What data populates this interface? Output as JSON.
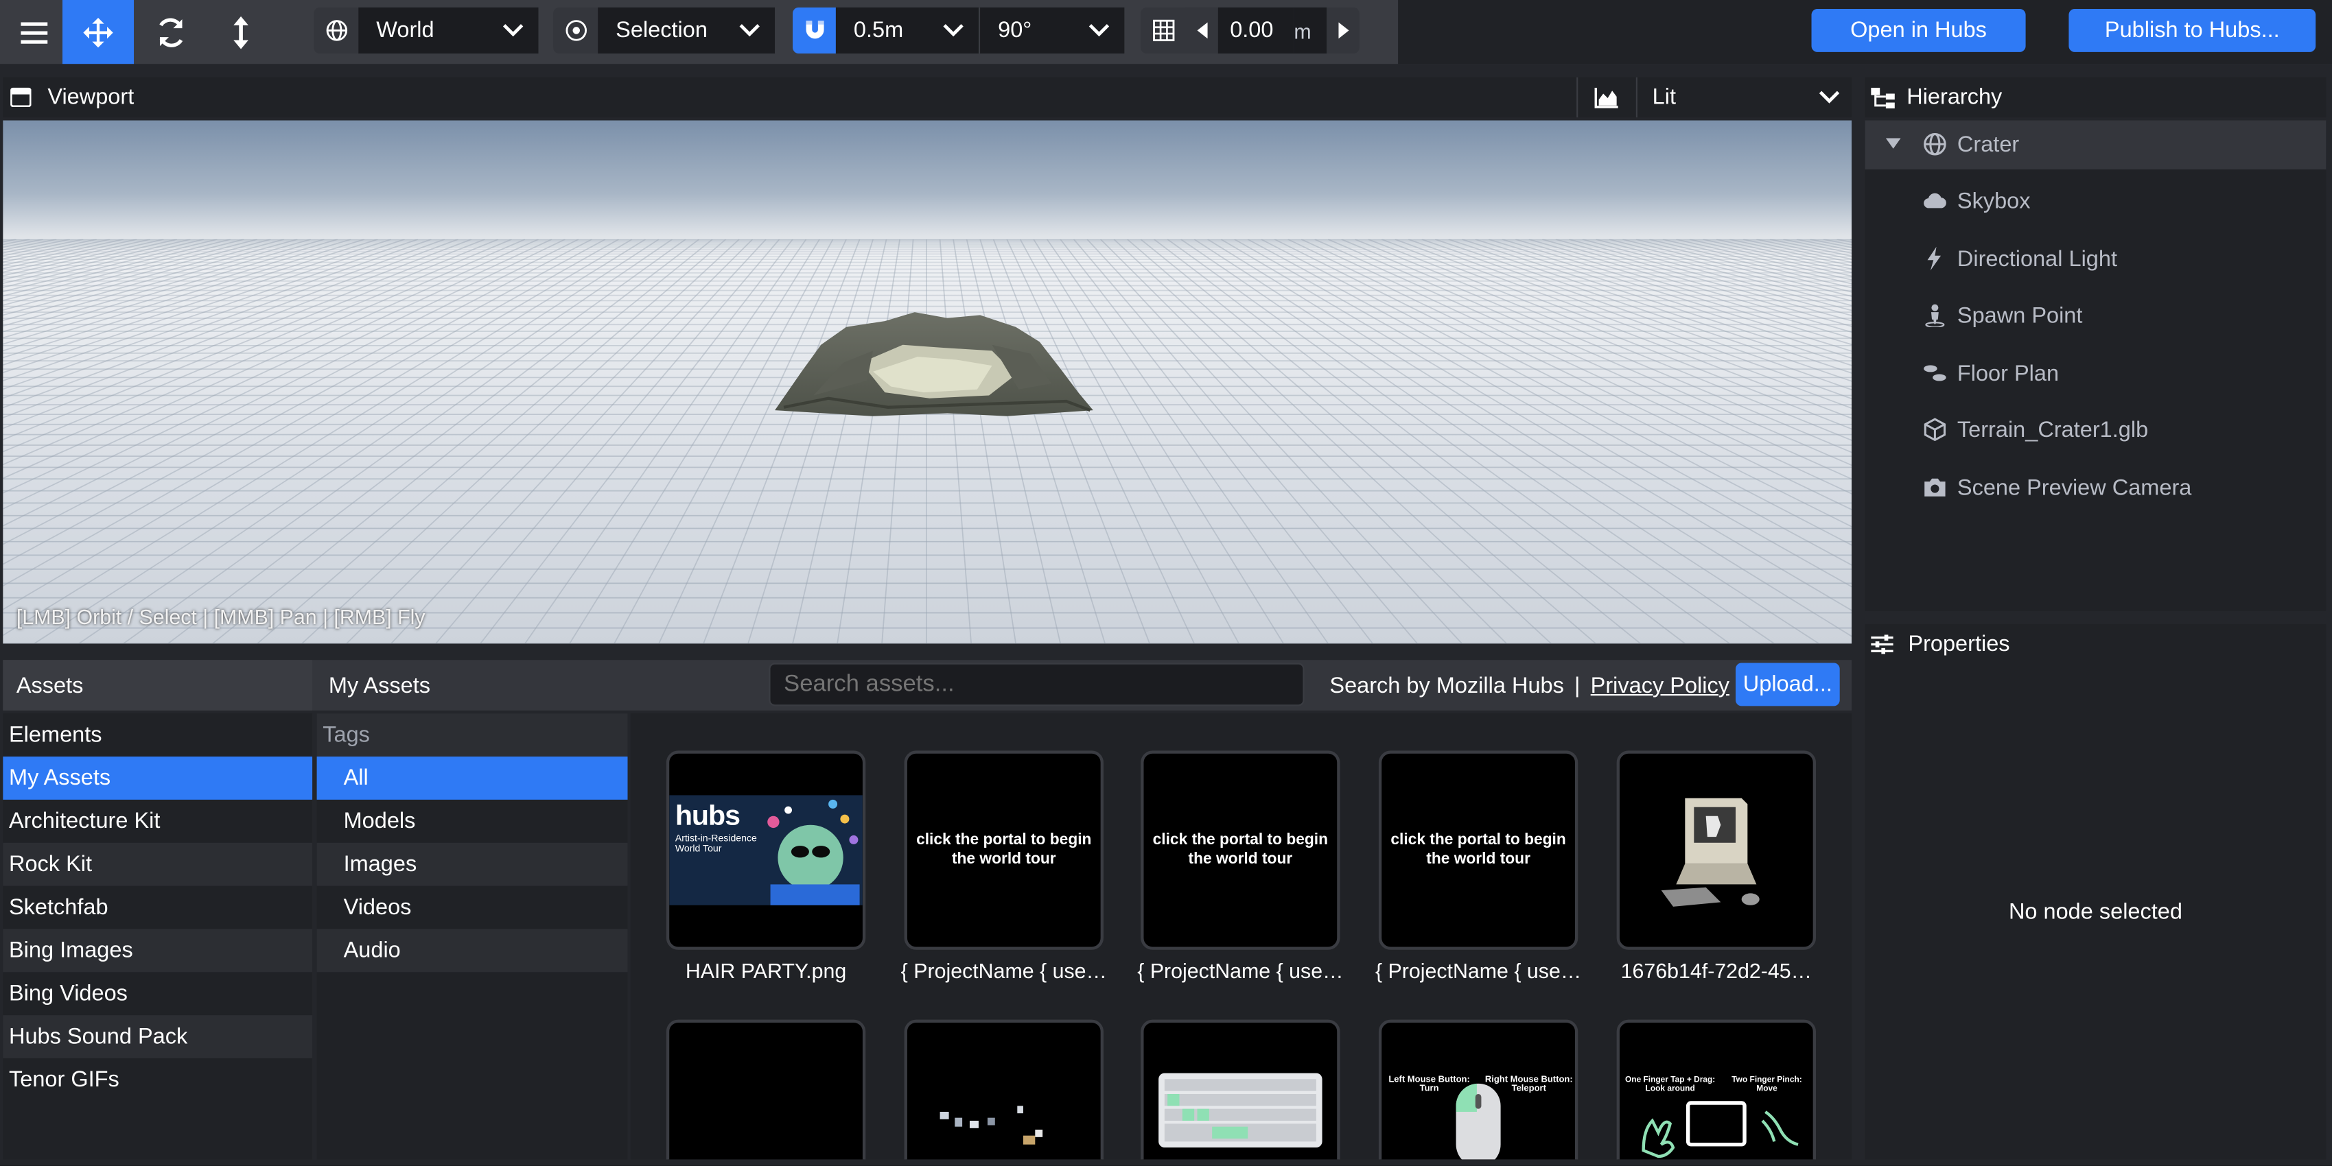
{
  "toolbar": {
    "coordinate_space": "World",
    "pivot_mode": "Selection",
    "snap_translation": "0.5m",
    "snap_rotation": "90°",
    "grid_height": "0.00",
    "grid_unit": "m",
    "open_in_hubs": "Open in Hubs",
    "publish": "Publish to Hubs...",
    "accent_color": "#2f7af5"
  },
  "viewport": {
    "title": "Viewport",
    "shading_mode": "Lit",
    "hint": "[LMB] Orbit / Select | [MMB] Pan | [RMB] Fly"
  },
  "hierarchy": {
    "title": "Hierarchy",
    "root": {
      "label": "Crater",
      "icon": "globe-icon"
    },
    "items": [
      {
        "label": "Skybox",
        "icon": "cloud-icon"
      },
      {
        "label": "Directional Light",
        "icon": "bolt-icon"
      },
      {
        "label": "Spawn Point",
        "icon": "person-icon"
      },
      {
        "label": "Floor Plan",
        "icon": "shoe-prints-icon"
      },
      {
        "label": "Terrain_Crater1.glb",
        "icon": "cube-icon"
      },
      {
        "label": "Scene Preview Camera",
        "icon": "camera-icon"
      }
    ]
  },
  "properties": {
    "title": "Properties",
    "empty_message": "No node selected"
  },
  "assets": {
    "title": "Assets",
    "current_source": "My Assets",
    "search_placeholder": "Search assets...",
    "search_by": "Search by Mozilla Hubs",
    "separator": "|",
    "privacy_policy": "Privacy Policy",
    "upload": "Upload...",
    "sources": [
      "Elements",
      "My Assets",
      "Architecture Kit",
      "Rock Kit",
      "Sketchfab",
      "Bing Images",
      "Bing Videos",
      "Hubs Sound Pack",
      "Tenor GIFs"
    ],
    "tags_header": "Tags",
    "tags": [
      "All",
      "Models",
      "Images",
      "Videos",
      "Audio"
    ],
    "tiles": [
      {
        "label": "HAIR PARTY.png",
        "preview": {
          "brand": "hubs",
          "line1": "Artist-in-Residence",
          "line2": "World Tour"
        }
      },
      {
        "label": "{ ProjectName { use…",
        "preview": {
          "text": "click the portal to begin the world tour"
        }
      },
      {
        "label": "{ ProjectName { use…",
        "preview": {
          "text": "click the portal to begin the world tour"
        }
      },
      {
        "label": "{ ProjectName { use…",
        "preview": {
          "text": "click the portal to begin the world tour"
        }
      },
      {
        "label": "1676b14f-72d2-45…",
        "preview": {}
      },
      {
        "label": "",
        "preview": {}
      },
      {
        "label": "",
        "preview": {}
      },
      {
        "label": "",
        "preview": {}
      },
      {
        "label": "",
        "preview": {
          "left": "Left Mouse Button:",
          "left_action": "Turn",
          "right": "Right Mouse Button:",
          "right_action": "Teleport"
        }
      },
      {
        "label": "",
        "preview": {
          "left": "One Finger Tap + Drag:",
          "left_action": "Look around",
          "right": "Two Finger Pinch:",
          "right_action": "Move"
        }
      }
    ]
  }
}
